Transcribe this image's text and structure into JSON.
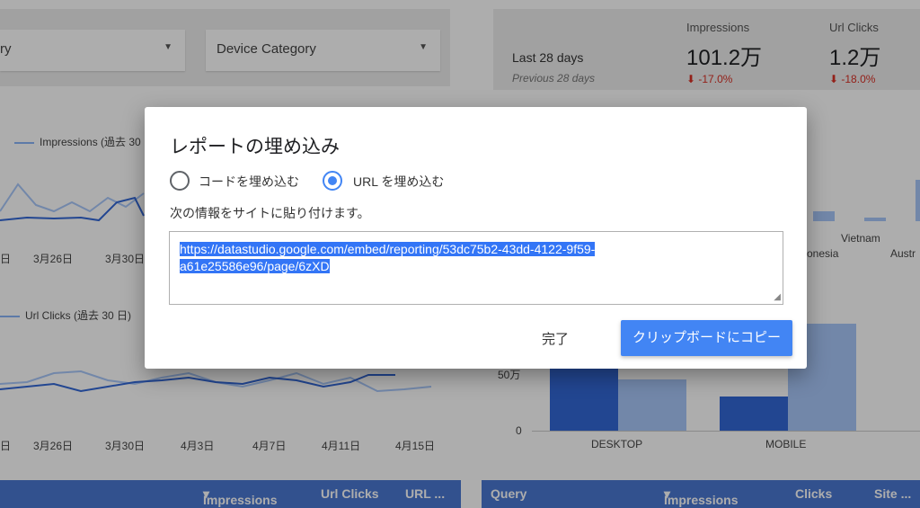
{
  "filters": {
    "first_visible": "ry",
    "device_category": "Device Category"
  },
  "scorecard": {
    "period": "Last 28 days",
    "previous": "Previous 28 days",
    "metrics": [
      {
        "label": "Impressions",
        "value": "101.2万",
        "delta": "-17.0%"
      },
      {
        "label": "Url Clicks",
        "value": "1.2万",
        "delta": "-18.0%"
      }
    ]
  },
  "charts": {
    "impressions_legend": "Impressions (過去 30",
    "urlclicks_legend": "Url Clicks (過去 30 日)",
    "top_ticks": [
      "日",
      "3月26日",
      "3月30日"
    ],
    "bottom_ticks": [
      "日",
      "3月26日",
      "3月30日",
      "4月3日",
      "4月7日",
      "4月11日",
      "4月15日"
    ],
    "country_labels": [
      "onesia",
      "Vietnam",
      "Austr"
    ],
    "device_ylabels": [
      "50万",
      "0"
    ],
    "device_categories": [
      "DESKTOP",
      "MOBILE"
    ]
  },
  "table_headers": {
    "left": [
      "Impressions",
      "Url Clicks",
      "URL ..."
    ],
    "right": [
      "Query",
      "Impressions",
      "Clicks",
      "Site ..."
    ]
  },
  "dialog": {
    "title": "レポートの埋め込み",
    "option_code": "コードを埋め込む",
    "option_url": "URL を埋め込む",
    "instruction": "次の情報をサイトに貼り付けます。",
    "embed_url_line1": "https://datastudio.google.com/embed/reporting/53dc75b2-43dd-4122-9f59-",
    "embed_url_line2": "a61e25586e96/page/6zXD",
    "done_label": "完了",
    "copy_label": "クリップボードにコピー"
  },
  "colors": {
    "accent": "#4285f4",
    "header_blue": "#4b78d1",
    "negative": "#d93025"
  }
}
